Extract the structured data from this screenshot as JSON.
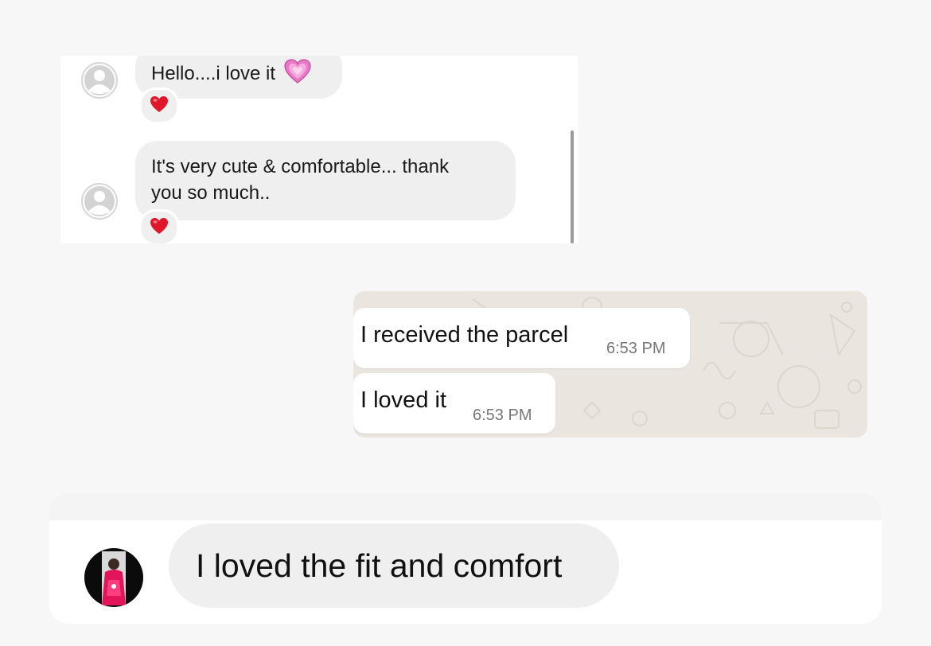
{
  "instagram_chat": {
    "messages": [
      {
        "text": "Hello....i love it",
        "emoji": "💗",
        "reaction": "❤️"
      },
      {
        "line1": "It's very cute & comfortable... thank",
        "line2": "you so much..",
        "reaction": "❤️"
      }
    ]
  },
  "whatsapp_chat": {
    "messages": [
      {
        "text": "I received the parcel",
        "time": "6:53 PM"
      },
      {
        "text": "I loved it",
        "time": "6:53 PM"
      }
    ]
  },
  "review_chat": {
    "message": "I loved the fit and comfort"
  },
  "colors": {
    "bubble_gray": "#efefef",
    "whatsapp_bg": "#eae6df",
    "heart_red": "#e0162b",
    "heart_pink": "#e879c6"
  },
  "icons": {
    "avatar_placeholder": "default-user-avatar",
    "reaction": "red-heart-emoji",
    "inline_emoji": "pink-beating-heart-emoji"
  }
}
